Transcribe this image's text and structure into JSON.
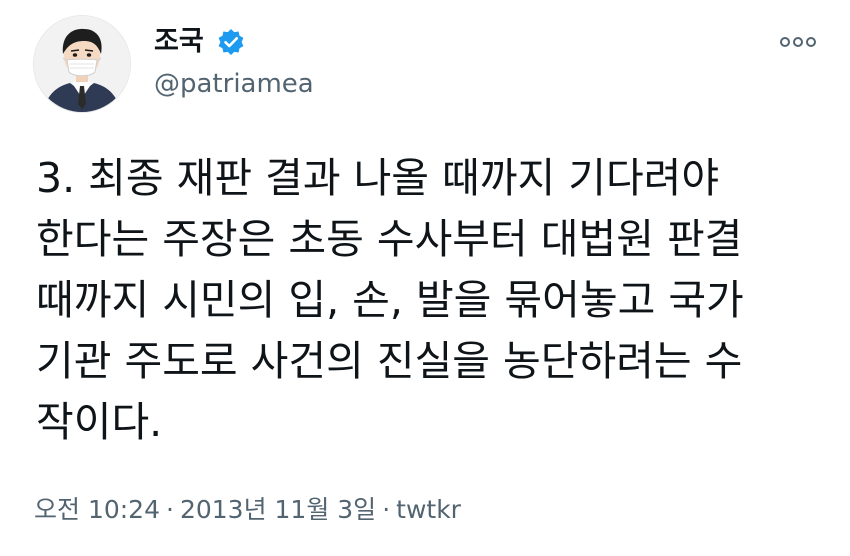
{
  "author": {
    "name": "조국",
    "handle": "@patriamea",
    "verified": true,
    "avatar": "avatar-illustration"
  },
  "menu": {
    "icon": "more-horizontal-icon"
  },
  "tweet": {
    "lines": [
      "3. 최종 재판 결과 나올 때까지 기다려야",
      "한다는 주장은 초동 수사부터 대법원 판결",
      "때까지 시민의 입, 손, 발을 묶어놓고 국가",
      "기관 주도로 사건의 진실을 농단하려는 수",
      "작이다."
    ]
  },
  "meta": {
    "time": "오전 10:24",
    "separator": "·",
    "date": "2013년 11월 3일",
    "source": "twtkr"
  },
  "colors": {
    "text": "#0f1419",
    "secondary": "#536471",
    "verified": "#1d9bf0",
    "background": "#ffffff"
  }
}
